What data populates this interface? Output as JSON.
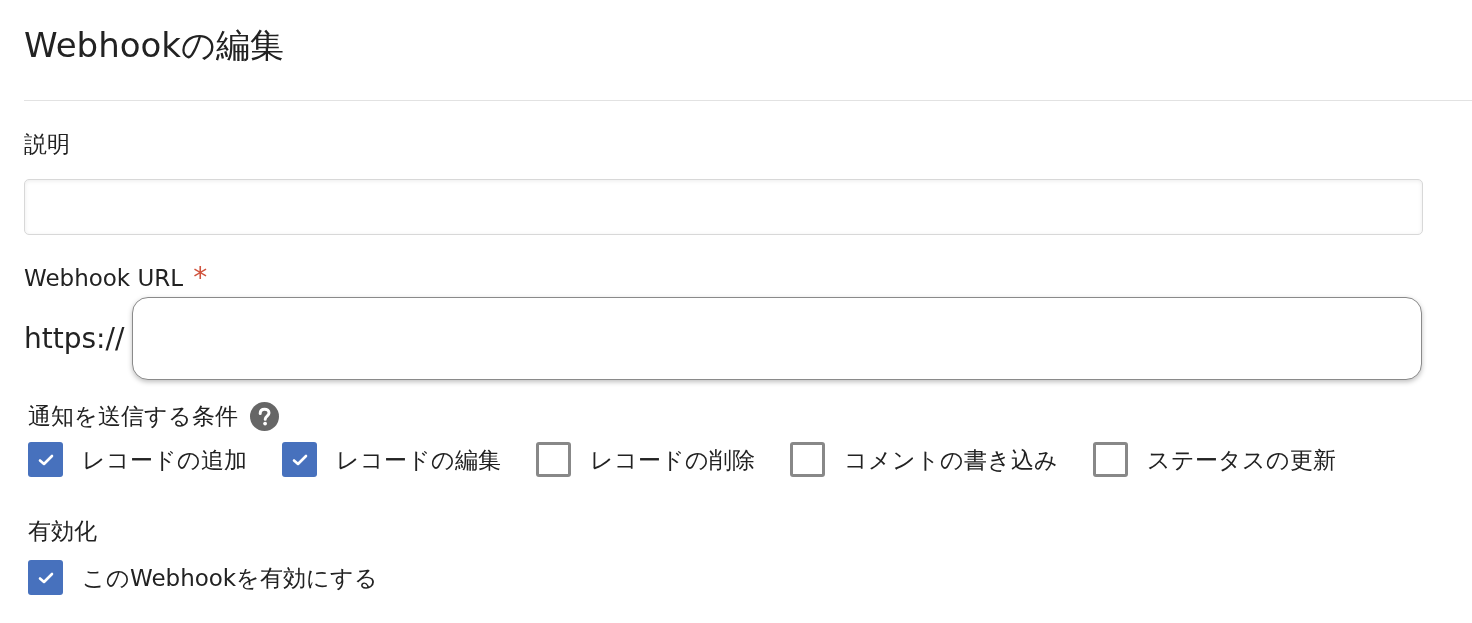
{
  "title": "Webhookの編集",
  "description": {
    "label": "説明"
  },
  "webhook_url": {
    "label": "Webhook URL",
    "required_mark": "*",
    "prefix": "https://"
  },
  "conditions": {
    "label": "通知を送信する条件",
    "options": [
      {
        "label": "レコードの追加",
        "checked": true
      },
      {
        "label": "レコードの編集",
        "checked": true
      },
      {
        "label": "レコードの削除",
        "checked": false
      },
      {
        "label": "コメントの書き込み",
        "checked": false
      },
      {
        "label": "ステータスの更新",
        "checked": false
      }
    ]
  },
  "activation": {
    "label": "有効化",
    "option": {
      "label": "このWebhookを有効にする",
      "checked": true
    }
  }
}
